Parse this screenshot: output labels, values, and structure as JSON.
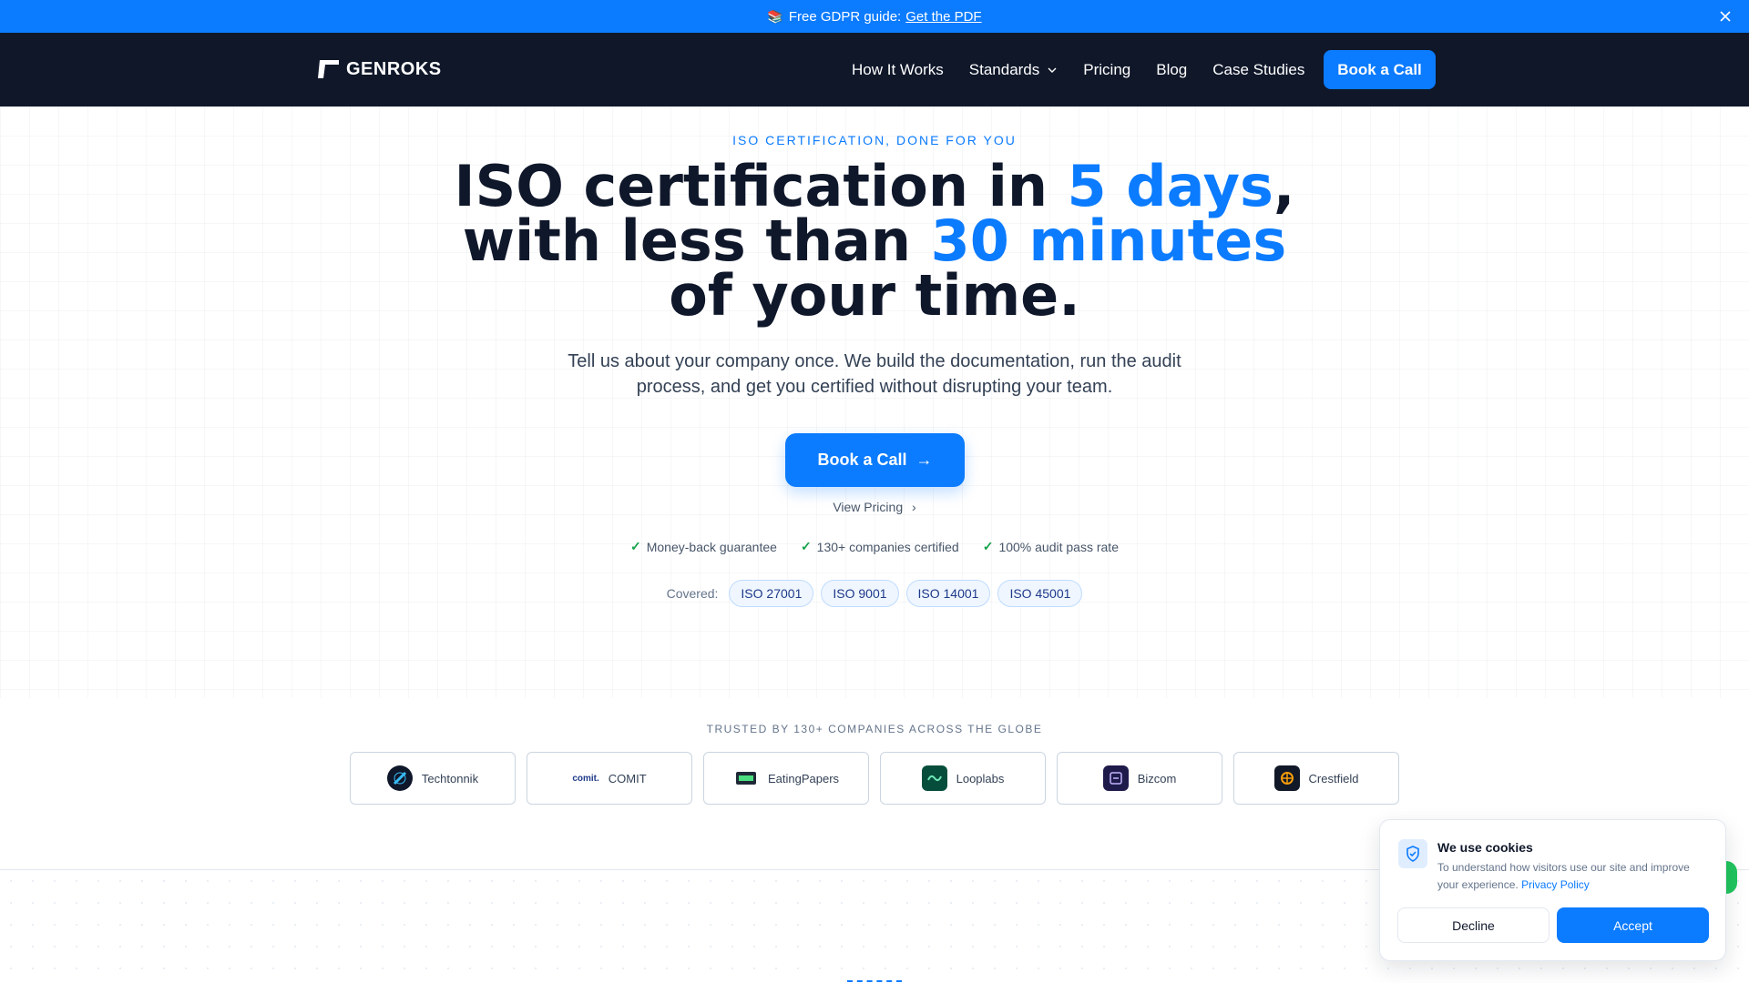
{
  "announcement": {
    "emoji": "📚",
    "text": "Free GDPR guide:",
    "link": "Get the PDF",
    "close_icon": "close-icon"
  },
  "nav": {
    "logo_text": "GENROKS",
    "items": [
      {
        "label": "How It Works"
      },
      {
        "label": "Standards",
        "has_dropdown": true
      },
      {
        "label": "Pricing"
      },
      {
        "label": "Blog"
      },
      {
        "label": "Case Studies"
      }
    ],
    "cta": "Book a Call"
  },
  "hero": {
    "eyebrow": "ISO CERTIFICATION, DONE FOR YOU",
    "headline": {
      "part1": "ISO certification in ",
      "accent1": "5 days",
      "part2": ",",
      "part3": "with less than ",
      "accent2": "30 minutes",
      "part4": "of your time."
    },
    "subtitle_line1": "Tell us about your company once. We build the documentation, run the audit",
    "subtitle_line2": "process, and get you certified without disrupting your team.",
    "cta": "Book a Call",
    "cta_arrow": "→",
    "secondary": "View Pricing",
    "secondary_chevron": "›",
    "badges": [
      "Money-back guarantee",
      "130+ companies certified",
      "100% audit pass rate"
    ],
    "covered_label": "Covered:",
    "standards": [
      "ISO 27001",
      "ISO 9001",
      "ISO 14001",
      "ISO 45001"
    ]
  },
  "trusted": {
    "title": "TRUSTED BY 130+ COMPANIES ACROSS THE GLOBE",
    "companies": [
      {
        "name": "Techtonnik",
        "icon": "techtonnik-logo-icon"
      },
      {
        "name": "COMIT",
        "icon": "comit-logo-icon",
        "mark": "comit."
      },
      {
        "name": "EatingPapers",
        "icon": "eatingpapers-logo-icon"
      },
      {
        "name": "Looplabs",
        "icon": "looplabs-logo-icon"
      },
      {
        "name": "Bizcom",
        "icon": "bizcom-logo-icon"
      },
      {
        "name": "Crestfield",
        "icon": "crestfield-logo-icon"
      }
    ]
  },
  "cookie": {
    "title": "We use cookies",
    "description": "To understand how visitors use our site and improve your experience.",
    "policy_link": "Privacy Policy",
    "decline": "Decline",
    "accept": "Accept"
  },
  "colors": {
    "accent": "#0b7bff",
    "nav_bg": "#0f1729",
    "text_dark": "#0f172a",
    "check": "#16a34a"
  }
}
